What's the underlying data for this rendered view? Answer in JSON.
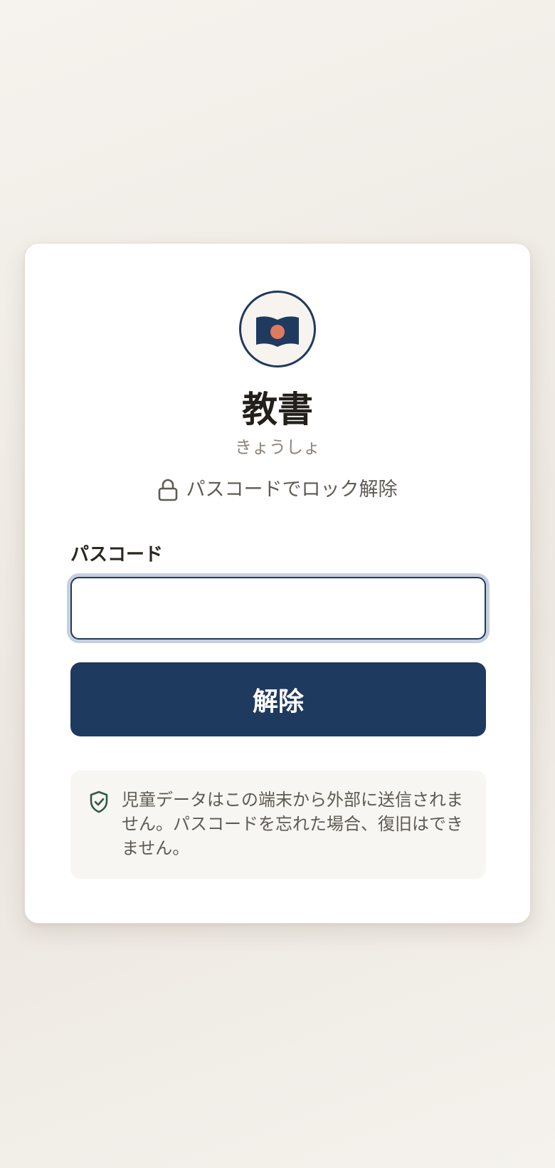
{
  "app": {
    "title": "教書",
    "reading": "きょうしょ",
    "logo_icon": "open-book-icon"
  },
  "lock": {
    "hint": "パスコードでロック解除",
    "icon": "lock-icon"
  },
  "form": {
    "passcode_label": "パスコード",
    "passcode_value": "",
    "unlock_button": "解除"
  },
  "notice": {
    "icon": "shield-check-icon",
    "text": "児童データはこの端末から外部に送信されません。パスコードを忘れた場合、復旧はできません。"
  },
  "colors": {
    "primary": "#1f3a5f",
    "accent": "#e07a5f",
    "shield": "#2f5a4a",
    "card": "#ffffff"
  }
}
